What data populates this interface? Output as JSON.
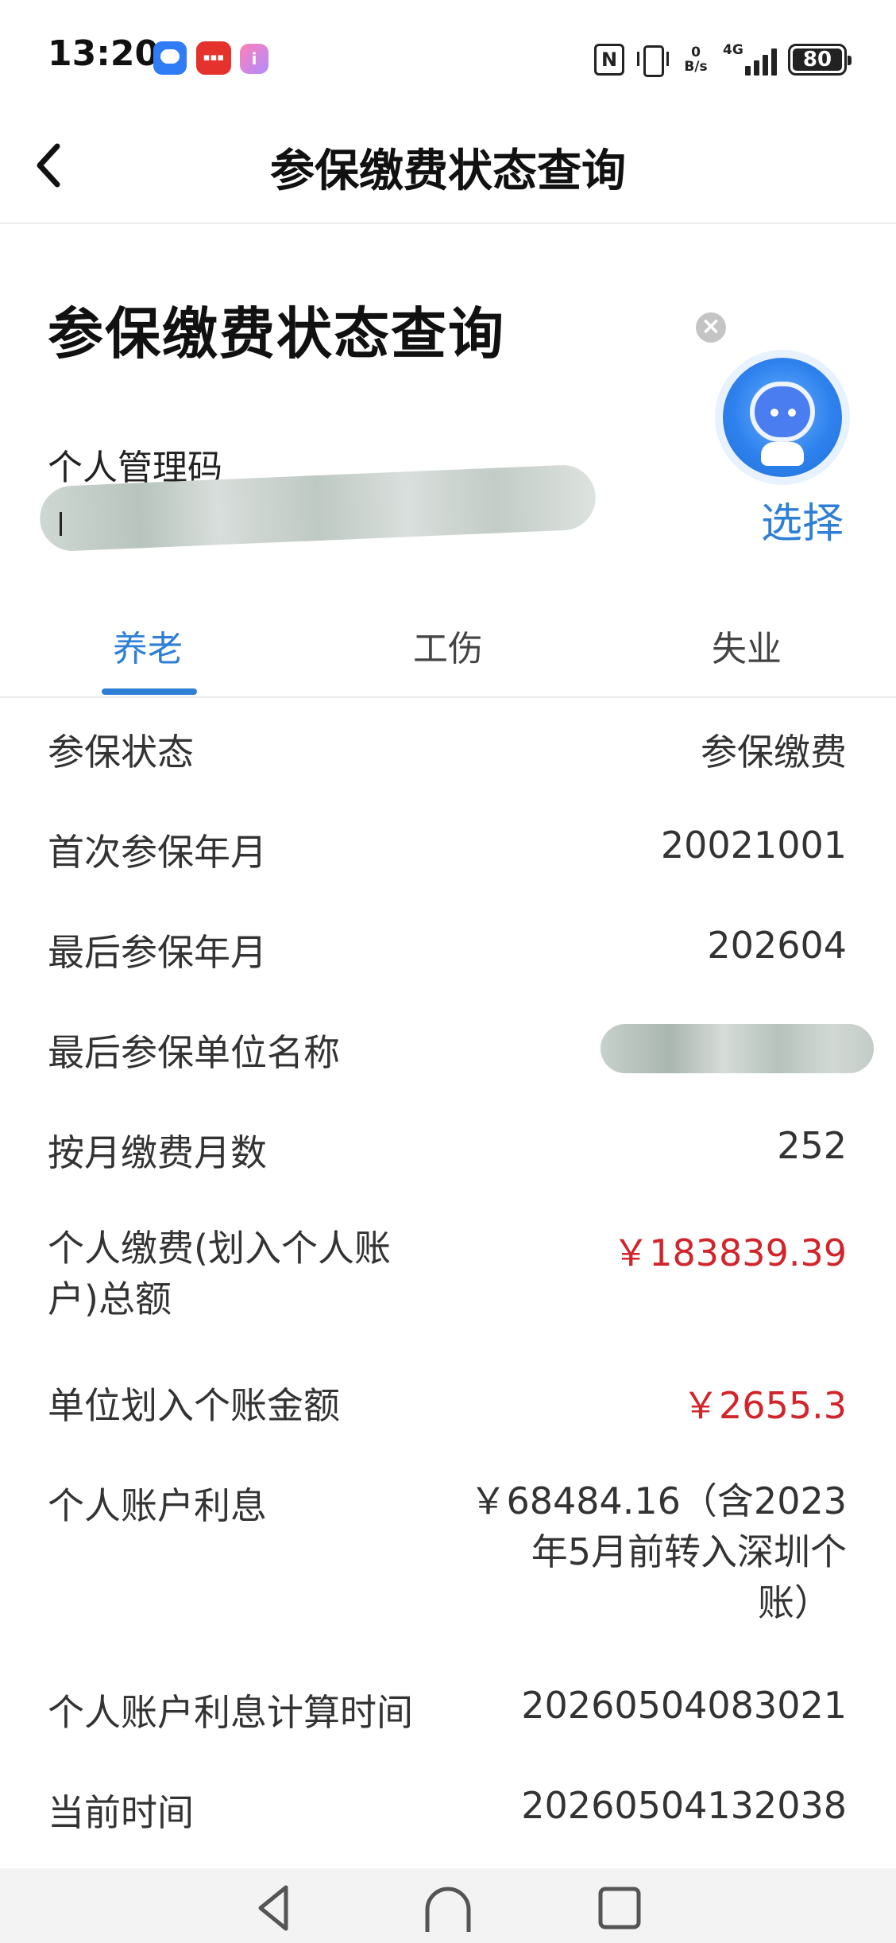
{
  "status_bar": {
    "time": "13:20",
    "notification_app": "i",
    "net_speed_value": "0",
    "net_speed_unit": "B/s",
    "network_type": "4G",
    "battery_level": "80"
  },
  "header": {
    "title": "参保缴费状态查询"
  },
  "page": {
    "title": "参保缴费状态查询",
    "code_label": "个人管理码",
    "select_label": "选择"
  },
  "tabs": [
    {
      "label": "养老",
      "active": true
    },
    {
      "label": "工伤",
      "active": false
    },
    {
      "label": "失业",
      "active": false
    }
  ],
  "details": [
    {
      "label": "参保状态",
      "value": "参保缴费"
    },
    {
      "label": "首次参保年月",
      "value": "20021001"
    },
    {
      "label": "最后参保年月",
      "value": "202604"
    },
    {
      "label": "最后参保单位名称",
      "value": ""
    },
    {
      "label": "按月缴费月数",
      "value": "252"
    },
    {
      "label_line1": "个人缴费(划入个人账",
      "label_line2": "户)总额",
      "value": "￥183839.39"
    },
    {
      "label": "单位划入个账金额",
      "value": "￥2655.3"
    },
    {
      "label": "个人账户利息",
      "value_line1": "￥68484.16（含2023",
      "value_line2": "年5月前转入深圳个",
      "value_line3": "账）"
    },
    {
      "label": "个人账户利息计算时间",
      "value": "20260504083021"
    },
    {
      "label": "当前时间",
      "value": "20260504132038"
    }
  ],
  "colors": {
    "accent": "#2f7fd6",
    "amount_red": "#d1252b"
  },
  "icons": [
    "message-icon",
    "notification-icon",
    "nfc-icon",
    "vibrate-icon",
    "signal-icon",
    "battery-icon",
    "back-arrow-icon",
    "close-icon",
    "assistant-robot-icon",
    "nav-back-icon",
    "nav-home-icon",
    "nav-recents-icon"
  ]
}
